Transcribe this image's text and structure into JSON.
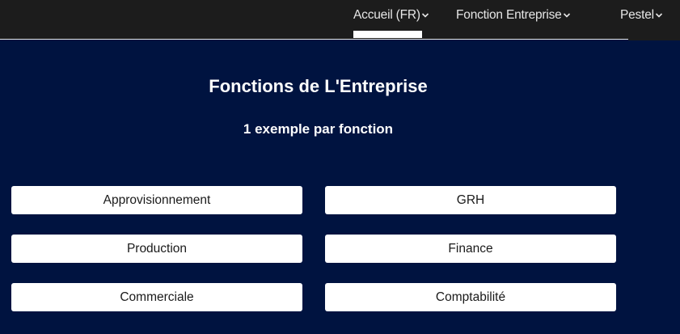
{
  "nav": {
    "items": [
      {
        "label": "Accueil (FR)",
        "icon": "chevron-down-icon",
        "active": true
      },
      {
        "label": "Fonction Entreprise",
        "icon": "chevron-down-icon",
        "active": false
      },
      {
        "label": "Pestel",
        "icon": "chevron-down-icon",
        "active": false
      }
    ]
  },
  "main": {
    "title": "Fonctions de L'Entreprise",
    "subtitle": "1 exemple par fonction",
    "functions": [
      "Approvisionnement",
      "GRH",
      "Production",
      "Finance",
      "Commerciale",
      "Comptabilité"
    ]
  },
  "colors": {
    "background": "#001340",
    "topbar": "#1c1c1c",
    "button": "#ffffff",
    "text_light": "#ffffff"
  }
}
